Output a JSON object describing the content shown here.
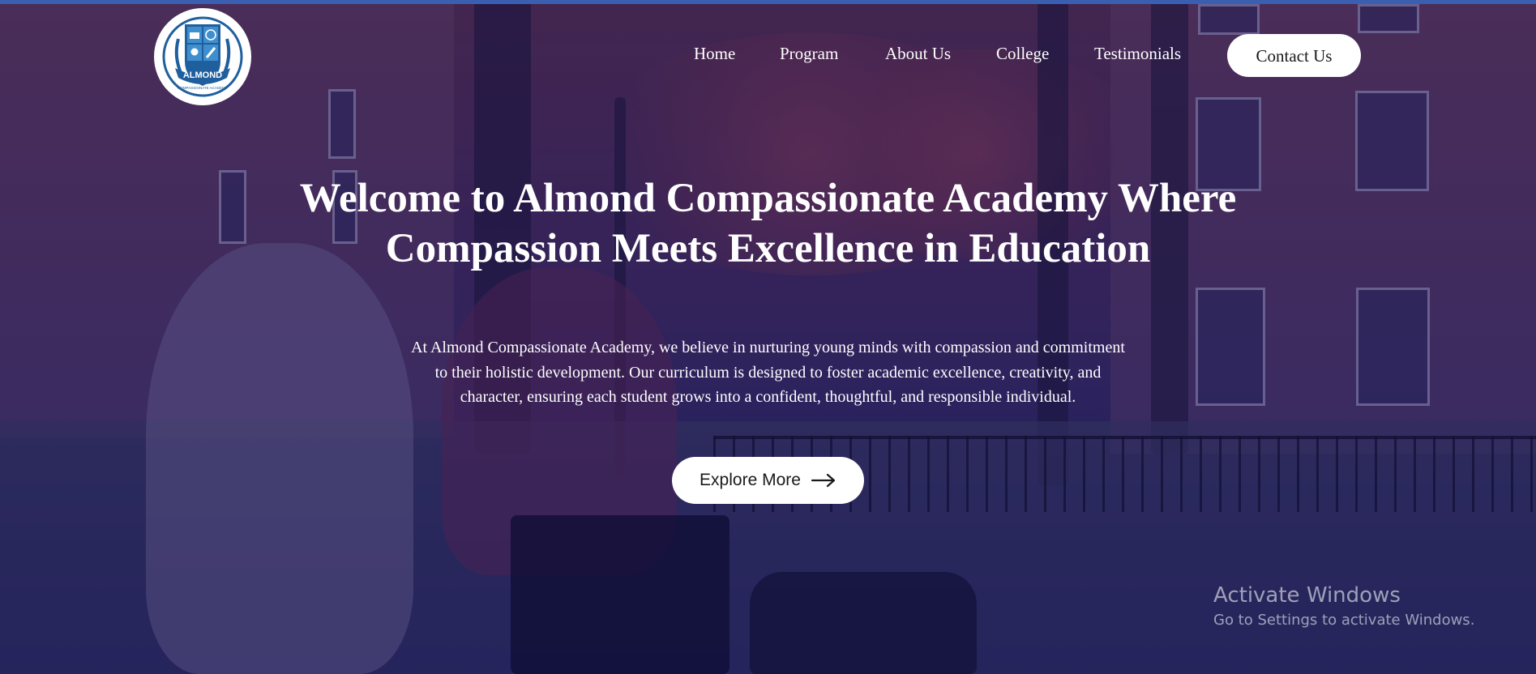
{
  "brand": {
    "logo_text": "ALMOND",
    "logo_subtext": "COMPASSIONATE ACADEMY"
  },
  "nav": {
    "items": [
      {
        "label": "Home"
      },
      {
        "label": "Program"
      },
      {
        "label": "About Us"
      },
      {
        "label": "College"
      },
      {
        "label": "Testimonials"
      }
    ],
    "contact_label": "Contact Us"
  },
  "hero": {
    "title": "Welcome to Almond Compassionate Academy Where Compassion Meets Excellence in Education",
    "description": "At Almond Compassionate Academy, we believe in nurturing young minds with compassion and commitment to their holistic development. Our curriculum is designed to foster academic excellence, creativity, and character, ensuring each student grows into a confident, thoughtful, and responsible individual.",
    "cta_label": "Explore More",
    "cta_icon": "arrow-right-icon"
  },
  "watermark": {
    "title": "Activate Windows",
    "subtitle": "Go to Settings to activate Windows."
  },
  "colors": {
    "overlay": "#1a165c",
    "button_bg": "#ffffff",
    "text": "#ffffff",
    "logo_blue": "#1f5f9e"
  }
}
